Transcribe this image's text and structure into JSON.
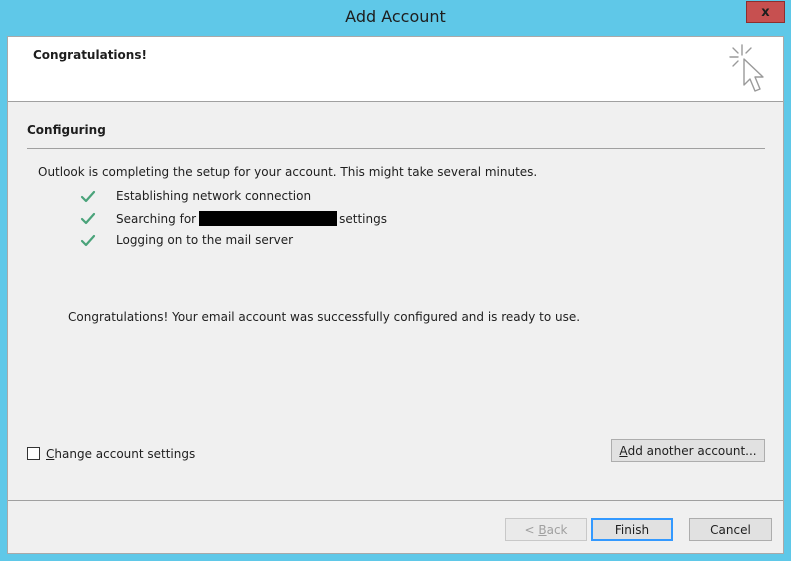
{
  "window": {
    "title": "Add Account",
    "close_label": "x"
  },
  "header": {
    "title": "Congratulations!",
    "icon": "cursor-sparkle-icon"
  },
  "section": {
    "title": "Configuring"
  },
  "intro_text": "Outlook is completing the setup for your account. This might take several minutes.",
  "steps": [
    {
      "text": "Establishing network connection",
      "status": "done"
    },
    {
      "prefix": "Searching for",
      "suffix": "settings",
      "status": "done"
    },
    {
      "text": "Logging on to the mail server",
      "status": "done"
    }
  ],
  "success_text": "Congratulations! Your email account was successfully configured and is ready to use.",
  "change_settings": {
    "accel": "C",
    "label_rest": "hange account settings",
    "checked": false
  },
  "buttons": {
    "add_another": {
      "accel": "A",
      "rest": "dd another account..."
    },
    "back": {
      "pre": "< ",
      "accel": "B",
      "rest": "ack"
    },
    "finish": "Finish",
    "cancel": "Cancel"
  },
  "colors": {
    "accent": "#5fc8e8",
    "check": "#4aa37a",
    "close": "#c75050"
  }
}
